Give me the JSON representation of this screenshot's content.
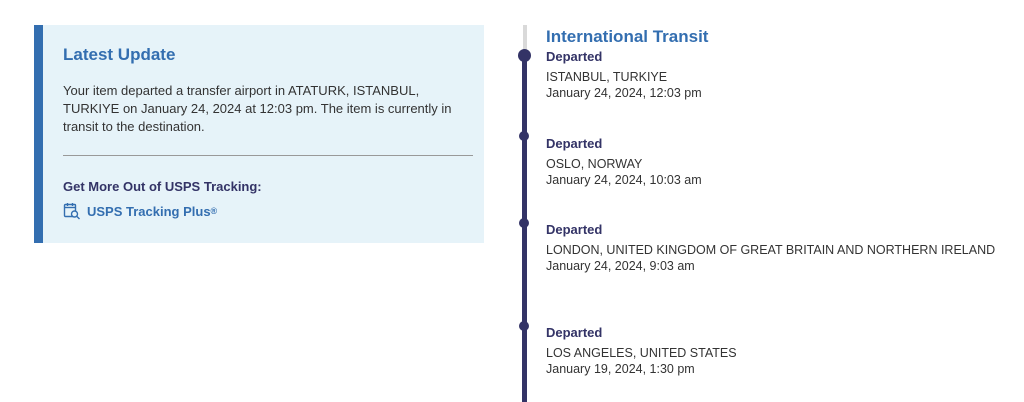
{
  "latest_update": {
    "title": "Latest Update",
    "body": "Your item departed a transfer airport in ATATURK, ISTANBUL, TURKIYE on January 24, 2024 at 12:03 pm. The item is currently in transit to the destination.",
    "more_label": "Get More Out of USPS Tracking:",
    "link_label": "USPS Tracking Plus",
    "link_mark": "®",
    "link_icon": "calendar-search-icon",
    "accent_color": "#336eb0",
    "background_color": "#e6f3f9"
  },
  "timeline": {
    "section_title": "International Transit",
    "line_color": "#333366",
    "events": [
      {
        "status": "Departed",
        "location": "ISTANBUL, TURKIYE",
        "time": "January 24, 2024, 12:03 pm"
      },
      {
        "status": "Departed",
        "location": "OSLO, NORWAY",
        "time": "January 24, 2024, 10:03 am"
      },
      {
        "status": "Departed",
        "location": "LONDON, UNITED KINGDOM OF GREAT BRITAIN AND NORTHERN IRELAND",
        "time": "January 24, 2024, 9:03 am"
      },
      {
        "status": "Departed",
        "location": "LOS ANGELES, UNITED STATES",
        "time": "January 19, 2024, 1:30 pm"
      }
    ]
  }
}
